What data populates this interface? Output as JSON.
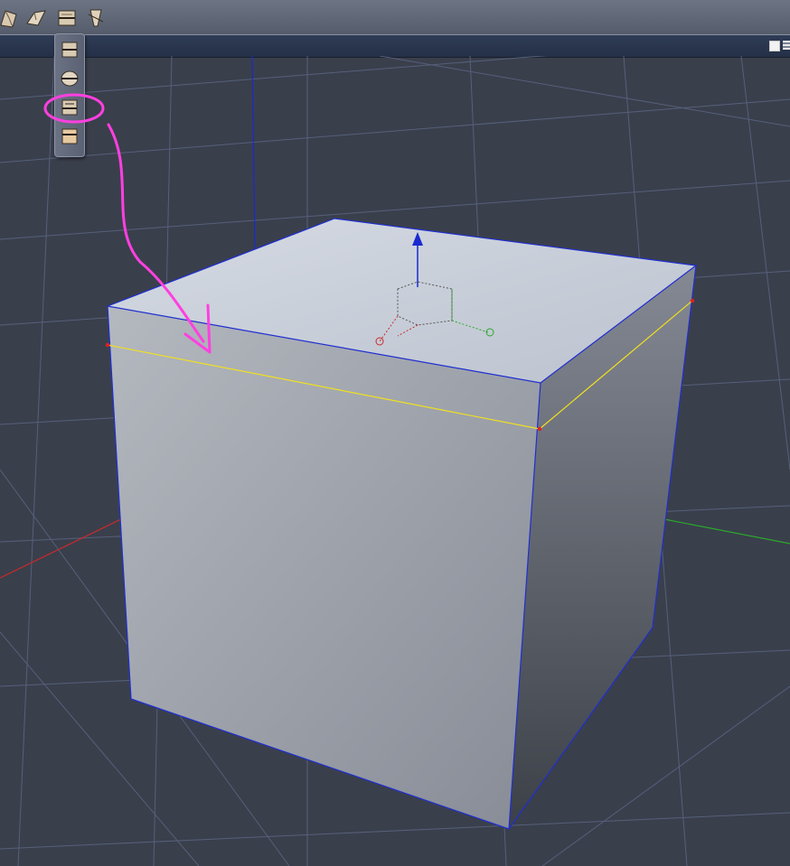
{
  "toolbar": {
    "tools": [
      {
        "name": "move-object-tool",
        "icon": "move-icon"
      },
      {
        "name": "rotate-object-tool",
        "icon": "rotate-icon"
      },
      {
        "name": "edge-tool-flyout",
        "icon": "edge-tool-icon"
      },
      {
        "name": "taper-tool",
        "icon": "taper-icon"
      }
    ]
  },
  "flyout": {
    "items": [
      {
        "name": "edge-split-tool",
        "icon": "edge-split-icon"
      },
      {
        "name": "edge-loop-tool",
        "icon": "edge-loop-icon"
      },
      {
        "name": "edge-ring-tool",
        "icon": "edge-ring-icon",
        "highlighted": true
      },
      {
        "name": "edge-bevel-tool",
        "icon": "edge-bevel-icon"
      }
    ]
  },
  "colors": {
    "viewport_bg": "#3a3f4c",
    "grid_line": "#55607a",
    "cube_top": "#c8ced8",
    "cube_front": "#9aa0aa",
    "cube_side": "#4c5058",
    "wire": "#1f2fd0",
    "edge_loop": "#f0e020",
    "annotation": "#ff40e0",
    "axis_x": "#c82a2a",
    "axis_y": "#2aa82a",
    "axis_z": "#1a2ad0"
  }
}
